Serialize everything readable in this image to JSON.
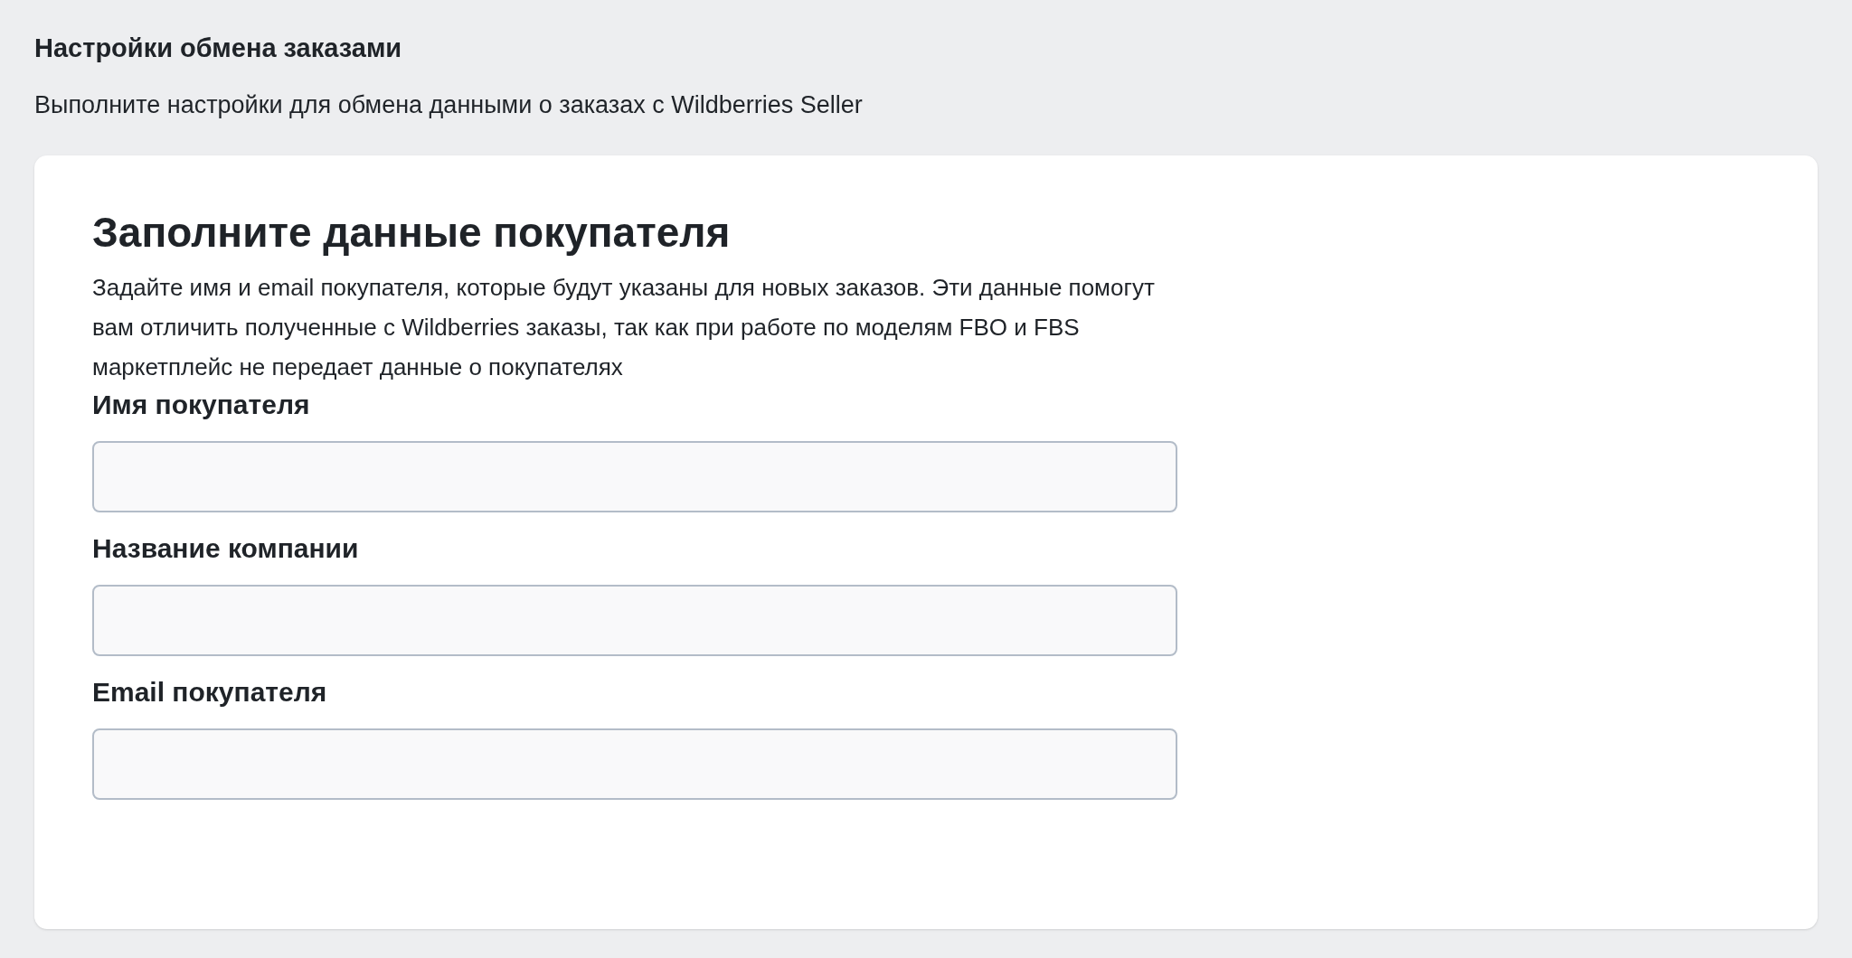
{
  "page": {
    "title": "Настройки обмена заказами",
    "subtitle": "Выполните настройки для обмена данными о заказах с Wildberries Seller"
  },
  "card": {
    "title": "Заполните данные покупателя",
    "description": "Задайте имя и email покупателя, которые будут указаны для новых заказов. Эти данные помогут вам отличить полученные с Wildberries заказы, так как при работе по моделям FBO и FBS маркетплейс не передает данные о покупателях",
    "fields": [
      {
        "label": "Имя покупателя"
      },
      {
        "label": "Название компании"
      },
      {
        "label": "Email покупателя"
      }
    ]
  }
}
